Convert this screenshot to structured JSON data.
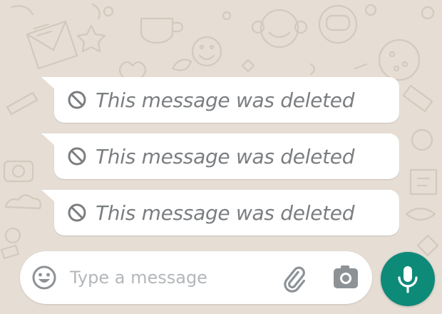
{
  "theme": {
    "background": "#e6ddd4",
    "bubble": "#ffffff",
    "deleted_text": "#7b7e81",
    "placeholder": "#b3b7ba",
    "icon": "#8d9296",
    "mic_button": "#0e8a78"
  },
  "messages": [
    {
      "text": "This message was deleted",
      "icon": "ban-icon",
      "status": "deleted"
    },
    {
      "text": "This message was deleted",
      "icon": "ban-icon",
      "status": "deleted"
    },
    {
      "text": "This message was deleted",
      "icon": "ban-icon",
      "status": "deleted"
    }
  ],
  "composer": {
    "placeholder": "Type a message",
    "value": "",
    "icons": [
      "emoji-icon",
      "attach-icon",
      "camera-icon"
    ]
  },
  "mic_button": {
    "icon": "microphone-icon"
  }
}
